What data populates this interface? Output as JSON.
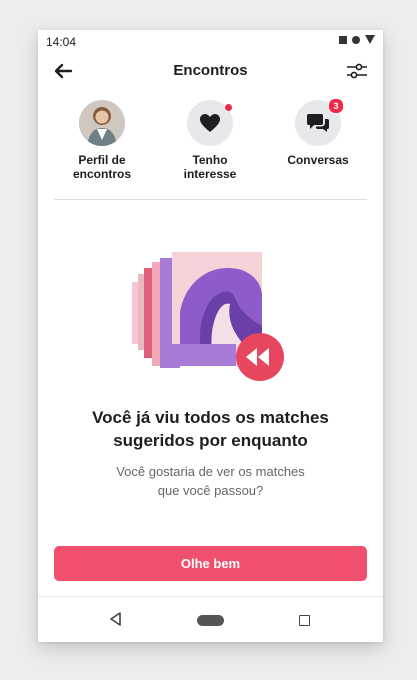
{
  "status_bar": {
    "time": "14:04"
  },
  "header": {
    "title": "Encontros"
  },
  "tabs": [
    {
      "label_line1": "Perfil de",
      "label_line2": "encontros",
      "icon": "avatar"
    },
    {
      "label_line1": "Tenho",
      "label_line2": "interesse",
      "icon": "heart-icon",
      "has_dot": true
    },
    {
      "label_line1": "Conversas",
      "label_line2": "",
      "icon": "chat-icon",
      "badge": "3"
    }
  ],
  "empty_state": {
    "headline_line1": "Você já viu todos os matches",
    "headline_line2": "sugeridos por enquanto",
    "sub_line1": "Você gostaria de ver os matches",
    "sub_line2": "que você passou?"
  },
  "cta": {
    "label": "Olhe bem"
  },
  "colors": {
    "accent": "#f0506e",
    "badge": "#f02849",
    "illustration_purple": "#7b4fb8"
  }
}
